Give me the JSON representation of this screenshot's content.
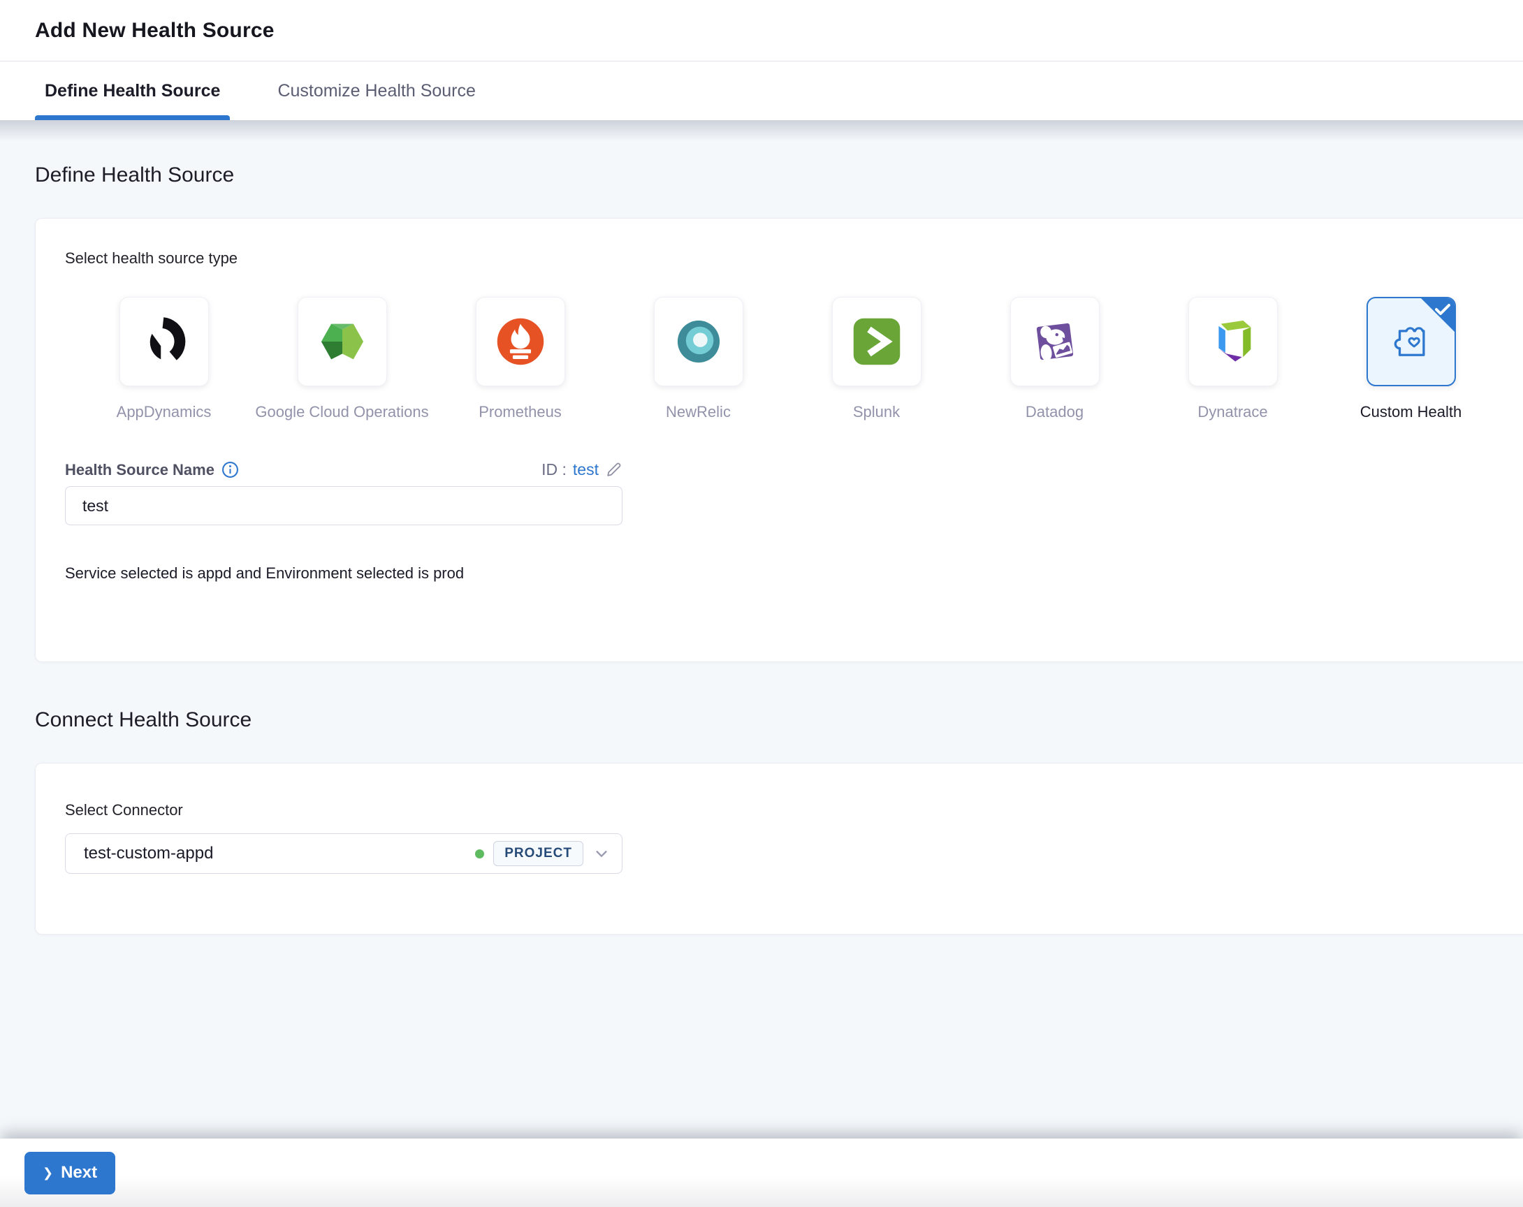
{
  "header": {
    "title": "Add New Health Source"
  },
  "tabs": [
    {
      "label": "Define Health Source",
      "active": true
    },
    {
      "label": "Customize Health Source",
      "active": false
    }
  ],
  "define": {
    "heading": "Define Health Source",
    "select_type_label": "Select health source type",
    "sources": [
      {
        "name": "AppDynamics",
        "icon": "appdynamics-icon",
        "selected": false
      },
      {
        "name": "Google Cloud Operations",
        "icon": "google-cloud-operations-icon",
        "selected": false
      },
      {
        "name": "Prometheus",
        "icon": "prometheus-icon",
        "selected": false
      },
      {
        "name": "NewRelic",
        "icon": "newrelic-icon",
        "selected": false
      },
      {
        "name": "Splunk",
        "icon": "splunk-icon",
        "selected": false
      },
      {
        "name": "Datadog",
        "icon": "datadog-icon",
        "selected": false
      },
      {
        "name": "Dynatrace",
        "icon": "dynatrace-icon",
        "selected": false
      },
      {
        "name": "Custom Health",
        "icon": "custom-health-icon",
        "selected": true
      }
    ],
    "name_label": "Health Source Name",
    "id_label": "ID :",
    "id_value": "test",
    "name_value": "test",
    "service_note": "Service selected is appd and Environment selected is prod"
  },
  "connect": {
    "heading": "Connect Health Source",
    "select_connector_label": "Select Connector",
    "connector_value": "test-custom-appd",
    "connector_scope": "PROJECT",
    "connector_status_color": "#5fbb5f"
  },
  "footer": {
    "next_label": "Next",
    "next_chevron": "❯"
  },
  "icons": {
    "info": "info-icon",
    "edit": "pencil-icon",
    "dropdown": "chevron-down-icon",
    "selected_check": "checkmark-icon"
  },
  "colors": {
    "accent_blue": "#2e77cf",
    "selected_tile_bg": "#eaf5fd",
    "content_bg": "#f4f8fb",
    "label_gray": "#9293ab",
    "badge_text": "#274b79"
  }
}
